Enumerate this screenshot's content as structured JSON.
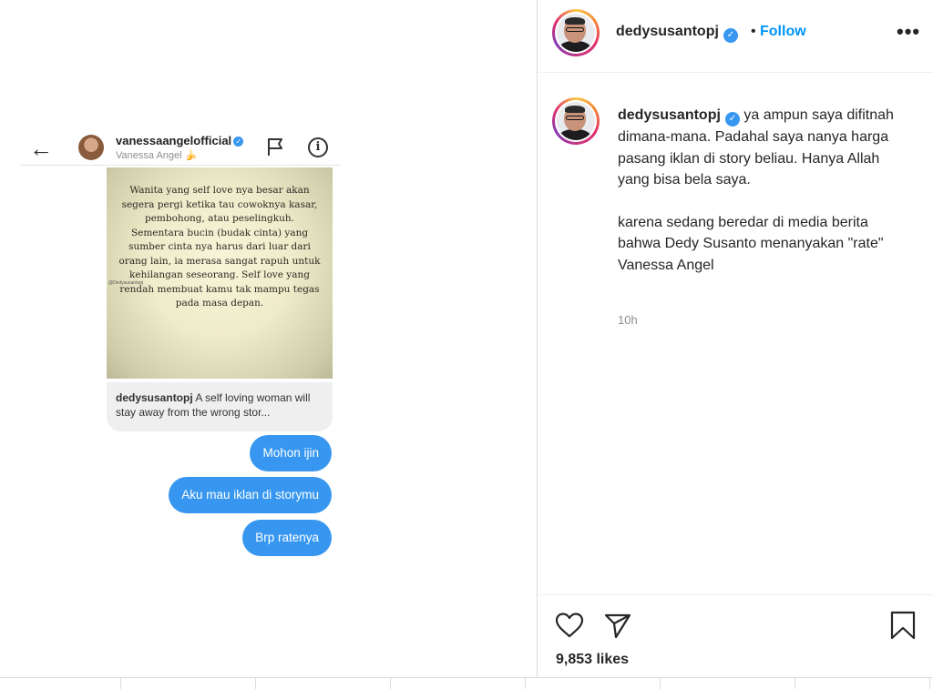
{
  "post": {
    "username": "dedysusantopj",
    "follow_label": "Follow",
    "separator": "•",
    "more_label": "•••",
    "caption_line1": "ya ampun saya difitnah dimana-mana. Padahal saya nanya harga pasang iklan di story beliau. Hanya Allah yang bisa bela saya.",
    "caption_line2": "karena sedang beredar di media berita bahwa Dedy Susanto menanyakan \"rate\" Vanessa Angel",
    "time": "10h",
    "likes": "9,853 likes"
  },
  "dm_screenshot": {
    "contact_username": "vanessaangelofficial",
    "contact_name": "Vanessa Angel 🍌",
    "back_icon": "←",
    "info_icon": "i",
    "story_text": "Wanita yang self love nya besar akan segera pergi ketika tau cowoknya kasar, pembohong, atau peselingkuh. Sementara bucin (budak cinta) yang sumber cinta nya harus dari luar dari orang lain, ia merasa sangat rapuh untuk kehilangan seseorang. Self love yang rendah membuat kamu tak mampu tegas pada masa depan.",
    "story_watermark": "@Dedysusantopj",
    "reply_username": "dedysusantopj",
    "reply_text": "A self loving woman will stay away from the wrong stor...",
    "messages": [
      "Mohon ijin",
      "Aku mau iklan di storymu",
      "Brp ratenya"
    ]
  },
  "icons": {
    "verified": "verified-badge",
    "heart": "heart-icon",
    "share": "paper-plane-icon",
    "save": "bookmark-icon",
    "more": "more-horizontal-icon"
  },
  "colors": {
    "accent": "#0095f6",
    "bubble": "#3797f0",
    "verified": "#3897f0"
  }
}
